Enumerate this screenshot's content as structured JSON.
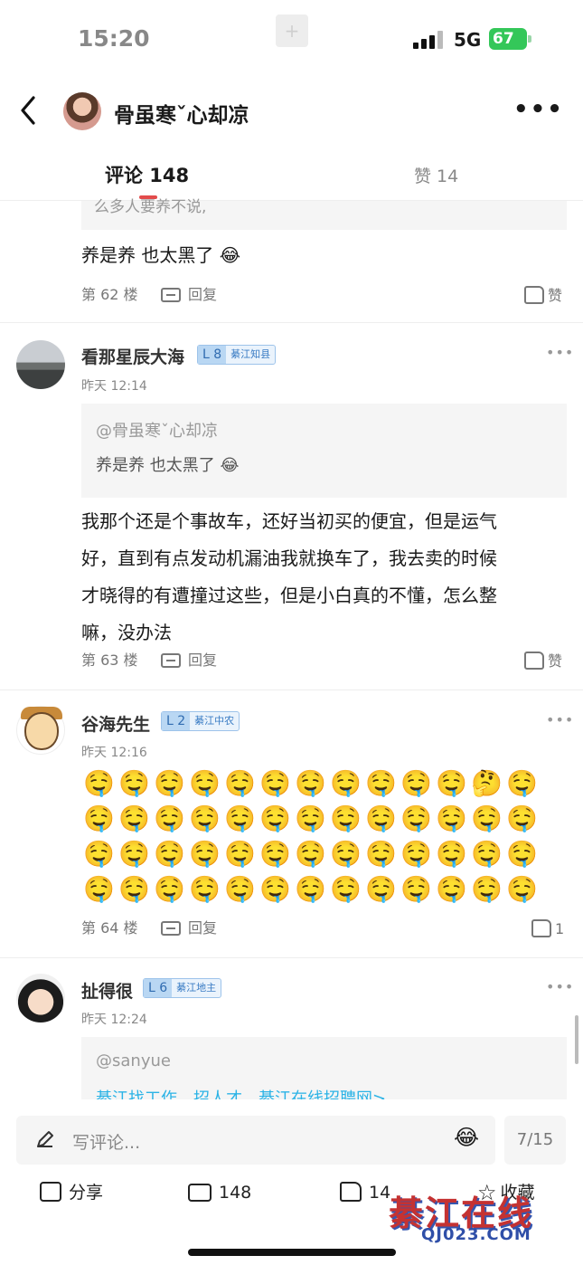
{
  "status_bar": {
    "time": "15:20",
    "network": "5G",
    "battery": "67"
  },
  "header": {
    "title": "骨虽寒ˇ心却凉"
  },
  "tabs": {
    "comments": "评论 148",
    "likes": "赞 14"
  },
  "comments": [
    {
      "quote_fragment": "么多人要养不说,",
      "text": "养是养 也太黑了 😂",
      "floor": "第 62 楼",
      "reply": "回复",
      "like": "赞"
    },
    {
      "user": "看那星辰大海",
      "level": "L 8",
      "title": "綦江知县",
      "time": "昨天 12:14",
      "quote_user": "@骨虽寒ˇ心却凉",
      "quote_text": "养是养 也太黑了 😂",
      "text_lines": [
        "我那个还是个事故车，还好当初买的便宜，但是运气",
        "好，直到有点发动机漏油我就换车了，我去卖的时候",
        "才晓得的有遭撞过这些，但是小白真的不懂，怎么整",
        "嘛，没办法"
      ],
      "floor": "第 63 楼",
      "reply": "回复",
      "like": "赞"
    },
    {
      "user": "谷海先生",
      "level": "L 2",
      "title": "綦江中农",
      "time": "昨天 12:16",
      "emoji_rows": [
        [
          "🤤",
          "🤤",
          "🤤",
          "🤤",
          "🤤",
          "🤤",
          "🤤",
          "🤤",
          "🤤",
          "🤤",
          "🤤",
          "🤔",
          "🤤"
        ],
        [
          "🤤",
          "🤤",
          "🤤",
          "🤤",
          "🤤",
          "🤤",
          "🤤",
          "🤤",
          "🤤",
          "🤤",
          "🤤",
          "🤤",
          "🤤"
        ],
        [
          "🤤",
          "🤤",
          "🤤",
          "🤤",
          "🤤",
          "🤤",
          "🤤",
          "🤤",
          "🤤",
          "🤤",
          "🤤",
          "🤤",
          "🤤"
        ],
        [
          "🤤",
          "🤤",
          "🤤",
          "🤤",
          "🤤",
          "🤤",
          "🤤",
          "🤤",
          "🤤",
          "🤤",
          "🤤",
          "🤤",
          "🤤"
        ]
      ],
      "floor": "第 64 楼",
      "reply": "回复",
      "like": "1"
    },
    {
      "user": "扯得很",
      "level": "L 6",
      "title": "綦江地主",
      "time": "昨天 12:24",
      "quote_user": "@sanyue",
      "quote_link": "綦江找工作，招人才，綦江在线招聘网>"
    }
  ],
  "bottom_bar": {
    "placeholder": "写评论...",
    "page": "7/15",
    "share": "分享",
    "comment_count": "148",
    "like_count": "14",
    "favorite": "收藏"
  },
  "watermark": {
    "line1": "綦江在线",
    "line2": "QJ023.COM"
  }
}
